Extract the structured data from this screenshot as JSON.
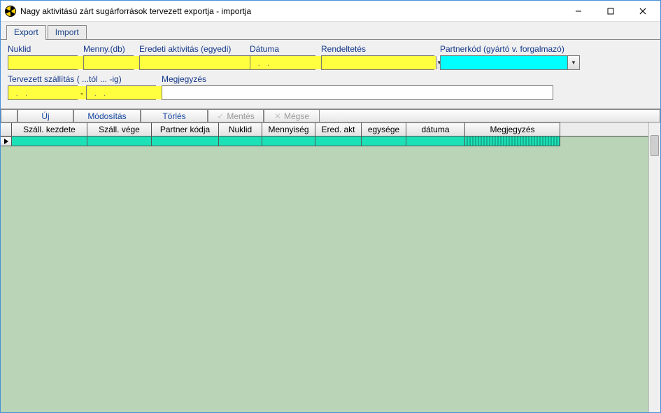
{
  "window": {
    "title": "Nagy aktivitású zárt sugárforrások tervezett exportja - importja"
  },
  "tabs": {
    "export": "Export",
    "import": "Import"
  },
  "form": {
    "nuklid_label": "Nuklid",
    "menny_label": "Menny.(db)",
    "eredeti_label": "Eredeti aktivitás (egyedi)",
    "datuma_label": "Dátuma",
    "rendeltetes_label": "Rendeltetés",
    "partnerkod_label": "Partnerkód (gyártó v. forgalmazó)",
    "tervezett_label": "Tervezett szállítás ( ...tól ... -ig)",
    "megjegyzes_label": "Megjegyzés",
    "date_placeholder": "  .   .",
    "date_sep": "-"
  },
  "actions": {
    "uj": "Új",
    "modositas": "Módosítás",
    "torles": "Törlés",
    "mentes": "Mentés",
    "megse": "Mégse"
  },
  "grid": {
    "columns": {
      "szall_kezdete": "Száll. kezdete",
      "szall_vege": "Száll. vége",
      "partner_kodja": "Partner kódja",
      "nuklid": "Nuklid",
      "mennyiseg": "Mennyiség",
      "ered_akt": "Ered. akt",
      "egysege": "egysége",
      "datuma": "dátuma",
      "megjegyzes": "Megjegyzés"
    },
    "rows": [
      {
        "szall_kezdete": "",
        "szall_vege": "",
        "partner_kodja": "",
        "nuklid": "",
        "mennyiseg": "",
        "ered_akt": "",
        "egysege": "",
        "datuma": "",
        "megjegyzes": ""
      }
    ]
  }
}
